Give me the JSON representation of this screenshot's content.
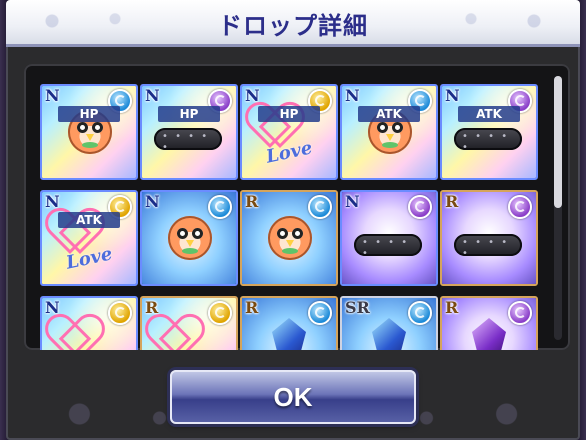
{
  "dialog": {
    "title": "ドロップ詳細",
    "ok_label": "OK"
  },
  "items": [
    {
      "rarity": "N",
      "element": "water",
      "icon": "bird-icon",
      "badge": "HP",
      "bg": "rainbow"
    },
    {
      "rarity": "N",
      "element": "moon",
      "icon": "collar-icon",
      "badge": "HP",
      "bg": "rainbow"
    },
    {
      "rarity": "N",
      "element": "thunder",
      "icon": "heart-love-icon",
      "badge": "HP",
      "bg": "rainbow"
    },
    {
      "rarity": "N",
      "element": "water",
      "icon": "bird-icon",
      "badge": "ATK",
      "bg": "rainbow"
    },
    {
      "rarity": "N",
      "element": "moon",
      "icon": "collar-icon",
      "badge": "ATK",
      "bg": "rainbow"
    },
    {
      "rarity": "N",
      "element": "thunder",
      "icon": "heart-love-icon",
      "badge": "ATK",
      "bg": "rainbow"
    },
    {
      "rarity": "N",
      "element": "water",
      "icon": "bird-icon",
      "badge": "",
      "bg": "blue"
    },
    {
      "rarity": "R",
      "element": "water",
      "icon": "bird-icon",
      "badge": "",
      "bg": "blue"
    },
    {
      "rarity": "N",
      "element": "moon",
      "icon": "collar-icon",
      "badge": "",
      "bg": "purple"
    },
    {
      "rarity": "R",
      "element": "moon",
      "icon": "collar-icon",
      "badge": "",
      "bg": "purple"
    },
    {
      "rarity": "N",
      "element": "thunder",
      "icon": "heart-love-icon",
      "badge": "",
      "bg": "rainbow"
    },
    {
      "rarity": "R",
      "element": "thunder",
      "icon": "heart-love-icon",
      "badge": "",
      "bg": "rainbow"
    },
    {
      "rarity": "R",
      "element": "water",
      "icon": "crystal-icon",
      "badge": "",
      "bg": "blue"
    },
    {
      "rarity": "SR",
      "element": "water",
      "icon": "crystal-icon",
      "badge": "",
      "bg": "blue"
    },
    {
      "rarity": "R",
      "element": "moon",
      "icon": "crystal-icon",
      "badge": "",
      "bg": "purple"
    }
  ],
  "scroll": {
    "thumb_fraction": 0.5,
    "position": 0.0
  }
}
